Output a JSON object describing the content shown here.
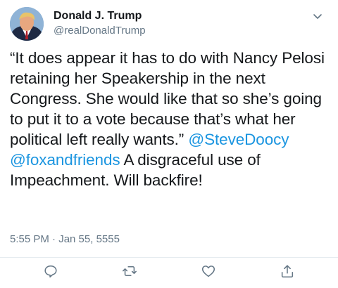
{
  "author": {
    "display_name": "Donald J. Trump",
    "handle": "@realDonaldTrump"
  },
  "tweet": {
    "text_before": "“It does appear it has to do with Nancy Pelosi retaining her Speakership in the next Congress. She would like that so she’s going to put it to a vote because that’s what her political left really wants.” ",
    "mention_1": "@SteveDoocy",
    "separator": " ",
    "mention_2": "@foxandfriends",
    "text_after": " A disgraceful use of Impeachment. Will backfire!",
    "timestamp": "5:55 PM · Jan 55, 5555"
  },
  "icons": {
    "menu": "chevron-down-icon",
    "reply": "comment-bubble-icon",
    "retweet": "retweet-arrows-icon",
    "like": "heart-outline-icon",
    "share": "share-upload-icon"
  },
  "colors": {
    "text": "#14171a",
    "secondary": "#657786",
    "link": "#1b95e0",
    "icon": "#657786",
    "divider": "#e6ecf0"
  }
}
